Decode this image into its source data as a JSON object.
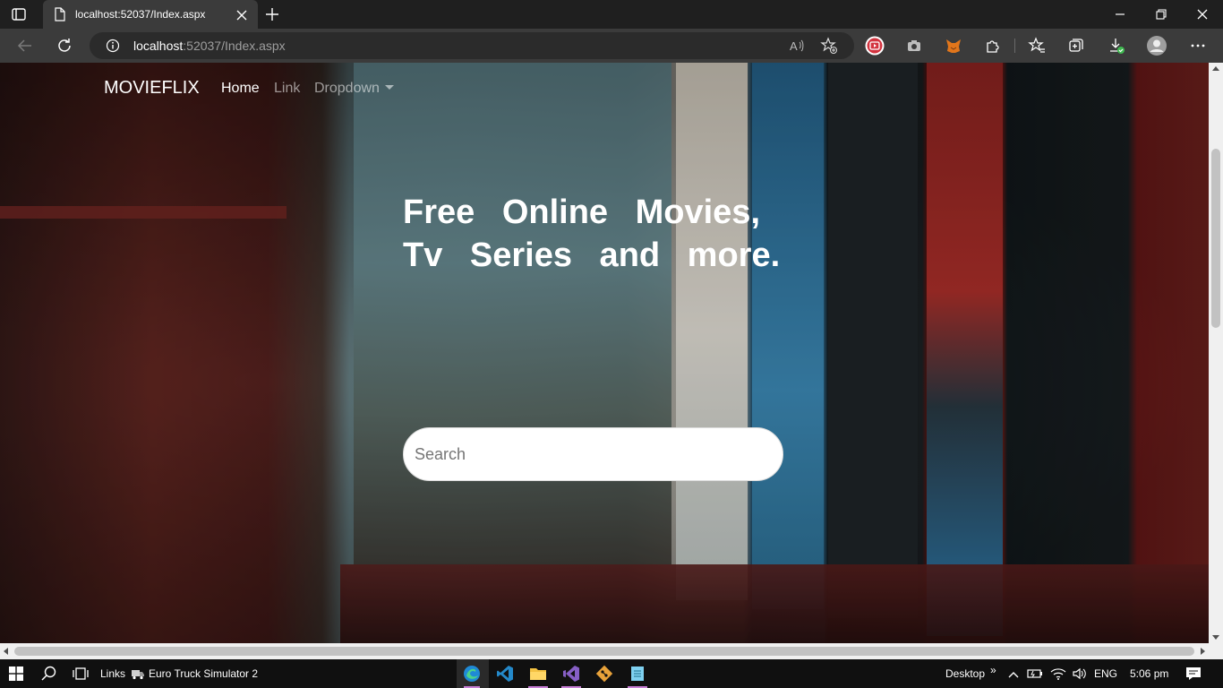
{
  "browser": {
    "tab": {
      "title": "localhost:52037/Index.aspx"
    },
    "address": {
      "host": "localhost",
      "path": ":52037/Index.aspx"
    }
  },
  "page": {
    "brand": "MOVIEFLIX",
    "nav": {
      "home": "Home",
      "link": "Link",
      "dropdown": "Dropdown"
    },
    "hero": {
      "line1": "Free Online Movies,",
      "line2": "Tv Series and more."
    },
    "search": {
      "placeholder": "Search"
    }
  },
  "taskbar": {
    "links_label": "Links",
    "app_label": "Euro Truck Simulator 2",
    "desktop_label": "Desktop",
    "chevron": "»",
    "language": "ENG",
    "time": "5:06 pm"
  },
  "colors": {
    "tabbar_bg": "#1f1f1f",
    "toolbar_bg": "#3b3b3b",
    "omnibox_bg": "#2b2b2b",
    "taskbar_bg": "#101010",
    "active_app_underline": "#c87fd6"
  }
}
